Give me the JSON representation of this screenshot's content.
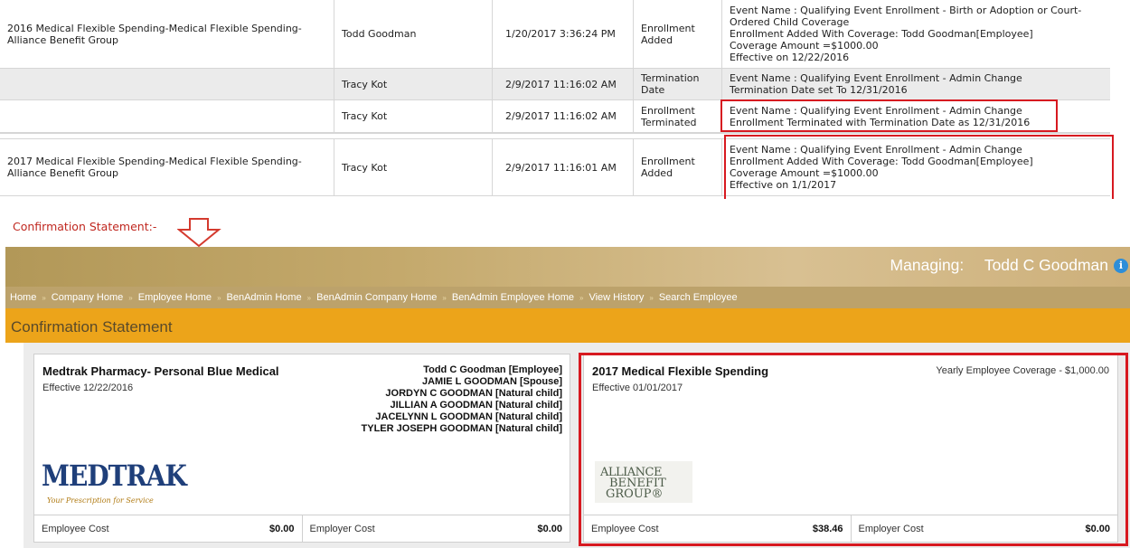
{
  "history": {
    "rows": [
      {
        "plan": "2016 Medical Flexible Spending-Medical Flexible Spending-Alliance Benefit Group",
        "user": "Todd Goodman",
        "date": "1/20/2017 3:36:24 PM",
        "action": "Enrollment Added",
        "details": [
          "Event Name : Qualifying Event Enrollment - Birth or Adoption or Court-Ordered Child Coverage",
          "Enrollment Added With Coverage: Todd Goodman[Employee]",
          "Coverage Amount =$1000.00",
          "Effective on 12/22/2016"
        ]
      },
      {
        "plan": "",
        "user": "Tracy Kot",
        "date": "2/9/2017 11:16:02 AM",
        "action": "Termination Date",
        "details": [
          "Event Name : Qualifying Event Enrollment - Admin Change",
          "Termination Date set To 12/31/2016"
        ]
      },
      {
        "plan": "",
        "user": "Tracy Kot",
        "date": "2/9/2017 11:16:02 AM",
        "action": "Enrollment Terminated",
        "details": [
          "Event Name : Qualifying Event Enrollment - Admin Change",
          "Enrollment Terminated with Termination Date as 12/31/2016"
        ]
      },
      {
        "plan": "2017 Medical Flexible Spending-Medical Flexible Spending-Alliance Benefit Group",
        "user": "Tracy Kot",
        "date": "2/9/2017 11:16:01 AM",
        "action": "Enrollment Added",
        "details": [
          "Event Name : Qualifying Event Enrollment - Admin Change",
          "Enrollment Added With Coverage: Todd Goodman[Employee]",
          "Coverage Amount =$1000.00",
          "Effective on 1/1/2017"
        ]
      }
    ]
  },
  "confirmation_label": "Confirmation Statement:-",
  "header": {
    "managing_label": "Managing:",
    "managing_name": "Todd C Goodman"
  },
  "breadcrumb": [
    "Home",
    "Company Home",
    "Employee Home",
    "BenAdmin Home",
    "BenAdmin Company Home",
    "BenAdmin Employee Home",
    "View History",
    "Search Employee"
  ],
  "page_title": "Confirmation Statement",
  "cards": [
    {
      "title": "Medtrak Pharmacy- Personal Blue Medical",
      "effective": "Effective 12/22/2016",
      "members": [
        "Todd C Goodman [Employee]",
        "JAMIE L GOODMAN [Spouse]",
        "JORDYN C GOODMAN [Natural child]",
        "JILLIAN A GOODMAN [Natural child]",
        "JACELYNN L GOODMAN [Natural child]",
        "TYLER JOSEPH GOODMAN [Natural child]"
      ],
      "logo_text": "MEDTRAK",
      "logo_tagline": "Your Prescription for Service",
      "employee_cost_label": "Employee Cost",
      "employee_cost": "$0.00",
      "employer_cost_label": "Employer Cost",
      "employer_cost": "$0.00"
    },
    {
      "title": "2017 Medical Flexible Spending",
      "effective": "Effective 01/01/2017",
      "yearly": "Yearly Employee Coverage - $1,000.00",
      "logo_lines": [
        "ALLIANCE",
        "BENEFIT",
        "GROUP®"
      ],
      "employee_cost_label": "Employee Cost",
      "employee_cost": "$38.46",
      "employer_cost_label": "Employer Cost",
      "employer_cost": "$0.00"
    }
  ],
  "colors": {
    "highlight_red": "#d71920",
    "title_bar": "#eca41a",
    "banner": "#c4a96c"
  }
}
